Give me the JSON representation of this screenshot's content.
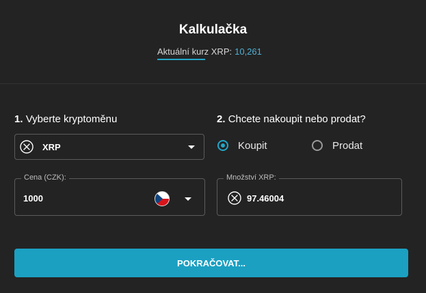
{
  "header": {
    "title": "Kalkulačka",
    "rate_label": "Aktuální kurz XRP:",
    "rate_value": "10,261"
  },
  "step1": {
    "number": "1.",
    "label": "Vyberte kryptoměnu",
    "selected_currency": "XRP",
    "currency_icon": "xrp-icon"
  },
  "step2": {
    "number": "2.",
    "label": "Chcete nakoupit nebo prodat?",
    "options": [
      {
        "label": "Koupit",
        "checked": true
      },
      {
        "label": "Prodat",
        "checked": false
      }
    ]
  },
  "price_field": {
    "legend": "Cena (CZK):",
    "value": "1000",
    "currency_flag": "czech-flag-icon"
  },
  "amount_field": {
    "legend": "Množství XRP:",
    "value": "97.46004",
    "currency_icon": "xrp-icon"
  },
  "cta": {
    "label": "POKRAČOVAT..."
  },
  "colors": {
    "background": "#232323",
    "accent": "#1ba0c2",
    "rate_value": "#4fb0d4"
  }
}
